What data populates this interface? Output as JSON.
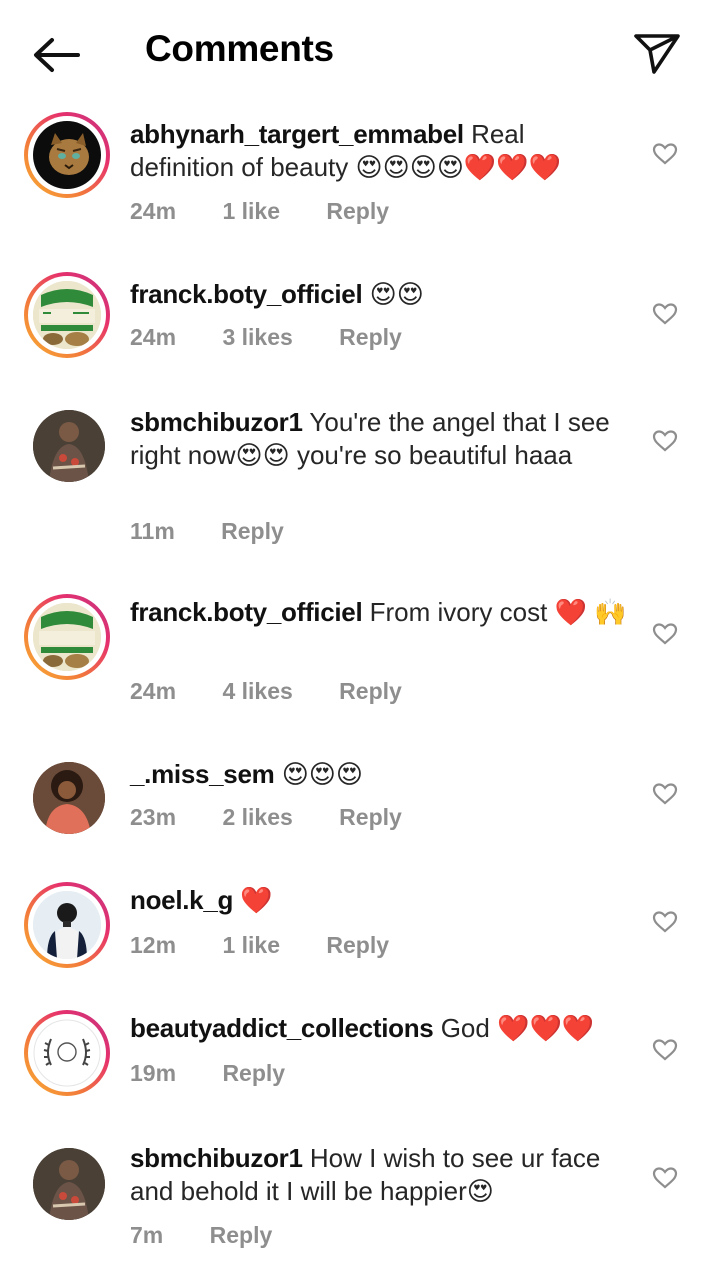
{
  "header": {
    "title": "Comments"
  },
  "comments": [
    {
      "username": "abhynarh_targert_emmabel",
      "text": "Real definition of beauty",
      "emoji": "😍😍😍😍❤️❤️❤️",
      "time": "24m",
      "likes": "1 like",
      "reply": "Reply"
    },
    {
      "username": "franck.boty_officiel",
      "text": "",
      "emoji": "😍😍",
      "time": "24m",
      "likes": "3 likes",
      "reply": "Reply"
    },
    {
      "username": "sbmchibuzor1",
      "text": "You're the angel that I see right now",
      "emoji": "😍😍",
      "text2": "you're so beautiful haaa",
      "time": "11m",
      "likes": "",
      "reply": "Reply"
    },
    {
      "username": "franck.boty_officiel",
      "text": "From ivory cost",
      "emoji": "❤️ 🙌",
      "time": "24m",
      "likes": "4 likes",
      "reply": "Reply"
    },
    {
      "username": "_.miss_sem",
      "text": "",
      "emoji": "😍😍😍",
      "time": "23m",
      "likes": "2 likes",
      "reply": "Reply"
    },
    {
      "username": "noel.k_g",
      "text": "",
      "emoji": "❤️",
      "time": "12m",
      "likes": "1 like",
      "reply": "Reply"
    },
    {
      "username": "beautyaddict_collections",
      "text": "God",
      "emoji": "❤️❤️❤️",
      "time": "19m",
      "likes": "",
      "reply": "Reply"
    },
    {
      "username": "sbmchibuzor1",
      "text": "How I wish to see ur face and behold it I will be happier",
      "emoji": "😍",
      "time": "7m",
      "likes": "",
      "reply": "Reply"
    }
  ],
  "colors": {
    "story_ring": "#e6306d",
    "meta_gray": "#8e8e8e",
    "heart_red": "#e0242e"
  },
  "icons": {
    "back": "arrow-left-icon",
    "share": "paper-plane-icon",
    "like": "heart-outline-icon"
  }
}
